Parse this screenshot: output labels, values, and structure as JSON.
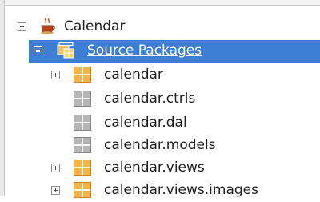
{
  "tree": {
    "project": {
      "label": "Calendar",
      "icon": "coffee-cup-icon",
      "expanded": true
    },
    "source_packages": {
      "label": "Source Packages",
      "icon": "source-folder-icon",
      "expanded": true,
      "selected": true
    },
    "packages": [
      {
        "label": "calendar",
        "icon": "package-icon",
        "color": "#f3b448",
        "expandable": true
      },
      {
        "label": "calendar.ctrls",
        "icon": "empty-package-icon",
        "color": "#b6b6b6",
        "expandable": false
      },
      {
        "label": "calendar.dal",
        "icon": "empty-package-icon",
        "color": "#b6b6b6",
        "expandable": false
      },
      {
        "label": "calendar.models",
        "icon": "empty-package-icon",
        "color": "#b6b6b6",
        "expandable": false
      },
      {
        "label": "calendar.views",
        "icon": "package-icon",
        "color": "#f3b448",
        "expandable": true
      },
      {
        "label": "calendar.views.images",
        "icon": "package-icon",
        "color": "#f3b448",
        "expandable": true
      }
    ]
  },
  "colors": {
    "selection": "#3d7fd5",
    "package": "#f3b448",
    "empty_package": "#b6b6b6"
  }
}
